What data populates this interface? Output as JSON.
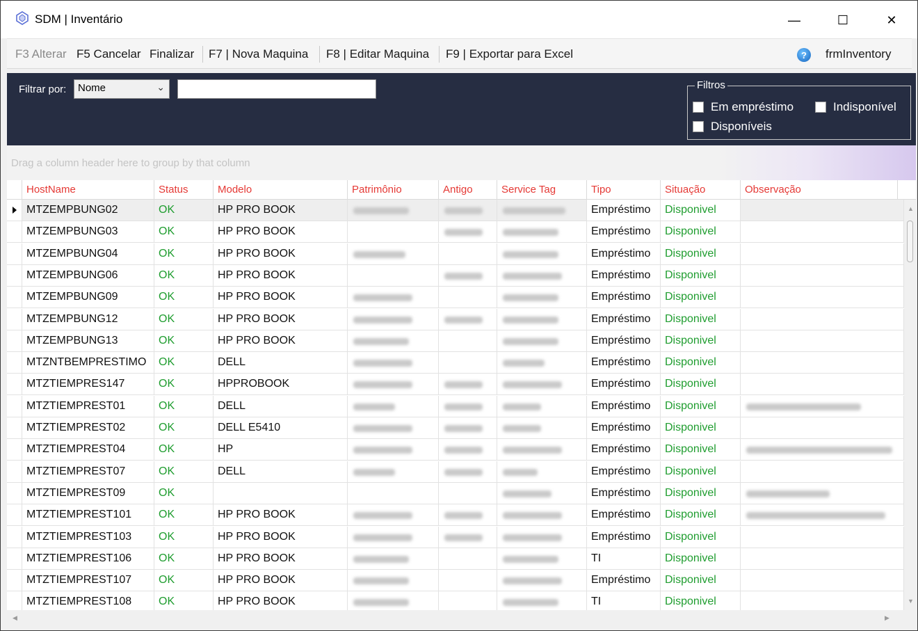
{
  "window": {
    "title": "SDM | Inventário",
    "minimize": "—",
    "maximize": "☐",
    "close": "✕"
  },
  "toolbar": {
    "alterar": "F3 Alterar",
    "cancelar": "F5 Cancelar",
    "finalizar": "Finalizar",
    "nova": "F7 | Nova Maquina",
    "editar": "F8 | Editar Maquina",
    "exportar": "F9 | Exportar para Excel",
    "help": "?",
    "form_name": "frmInventory"
  },
  "filter": {
    "label": "Filtrar por:",
    "selected": "Nome",
    "text_value": "",
    "group_title": "Filtros",
    "emprestimo": "Em empréstimo",
    "indisponivel": "Indisponível",
    "disponiveis": "Disponíveis"
  },
  "grid": {
    "group_hint": "Drag a column header here to group by that column",
    "columns": [
      "HostName",
      "Status",
      "Modelo",
      "Patrimônio",
      "Antigo",
      "Service Tag",
      "Tipo",
      "Situação",
      "Observação"
    ],
    "rows": [
      {
        "host": "MTZEMPBUNG02",
        "status": "OK",
        "modelo": "HP PRO BOOK",
        "tipo": "Empréstimo",
        "situacao": "Disponivel"
      },
      {
        "host": "MTZEMPBUNG03",
        "status": "OK",
        "modelo": "HP PRO BOOK",
        "tipo": "Empréstimo",
        "situacao": "Disponivel"
      },
      {
        "host": "MTZEMPBUNG04",
        "status": "OK",
        "modelo": "HP PRO BOOK",
        "tipo": "Empréstimo",
        "situacao": "Disponivel"
      },
      {
        "host": "MTZEMPBUNG06",
        "status": "OK",
        "modelo": "HP PRO BOOK",
        "tipo": "Empréstimo",
        "situacao": "Disponivel"
      },
      {
        "host": "MTZEMPBUNG09",
        "status": "OK",
        "modelo": "HP PRO BOOK",
        "tipo": "Empréstimo",
        "situacao": "Disponivel"
      },
      {
        "host": "MTZEMPBUNG12",
        "status": "OK",
        "modelo": "HP PRO BOOK",
        "tipo": "Empréstimo",
        "situacao": "Disponivel"
      },
      {
        "host": "MTZEMPBUNG13",
        "status": "OK",
        "modelo": "HP PRO BOOK",
        "tipo": "Empréstimo",
        "situacao": "Disponivel"
      },
      {
        "host": "MTZNTBEMPRESTIMO",
        "status": "OK",
        "modelo": "DELL",
        "tipo": "Empréstimo",
        "situacao": "Disponivel"
      },
      {
        "host": "MTZTIEMPRES147",
        "status": "OK",
        "modelo": "HPPROBOOK",
        "tipo": "Empréstimo",
        "situacao": "Disponivel"
      },
      {
        "host": "MTZTIEMPREST01",
        "status": "OK",
        "modelo": "DELL",
        "tipo": "Empréstimo",
        "situacao": "Disponivel"
      },
      {
        "host": "MTZTIEMPREST02",
        "status": "OK",
        "modelo": "DELL E5410",
        "tipo": "Empréstimo",
        "situacao": "Disponivel"
      },
      {
        "host": "MTZTIEMPREST04",
        "status": "OK",
        "modelo": "HP",
        "tipo": "Empréstimo",
        "situacao": "Disponivel"
      },
      {
        "host": "MTZTIEMPREST07",
        "status": "OK",
        "modelo": "DELL",
        "tipo": "Empréstimo",
        "situacao": "Disponivel"
      },
      {
        "host": "MTZTIEMPREST09",
        "status": "OK",
        "modelo": "",
        "tipo": "Empréstimo",
        "situacao": "Disponivel"
      },
      {
        "host": "MTZTIEMPREST101",
        "status": "OK",
        "modelo": "HP PRO BOOK",
        "tipo": "Empréstimo",
        "situacao": "Disponivel"
      },
      {
        "host": "MTZTIEMPREST103",
        "status": "OK",
        "modelo": "HP PRO BOOK",
        "tipo": "Empréstimo",
        "situacao": "Disponivel"
      },
      {
        "host": "MTZTIEMPREST106",
        "status": "OK",
        "modelo": "HP PRO BOOK",
        "tipo": "TI",
        "situacao": "Disponivel"
      },
      {
        "host": "MTZTIEMPREST107",
        "status": "OK",
        "modelo": "HP PRO BOOK",
        "tipo": "Empréstimo",
        "situacao": "Disponivel"
      },
      {
        "host": "MTZTIEMPREST108",
        "status": "OK",
        "modelo": "HP PRO BOOK",
        "tipo": "TI",
        "situacao": "Disponivel"
      }
    ]
  }
}
